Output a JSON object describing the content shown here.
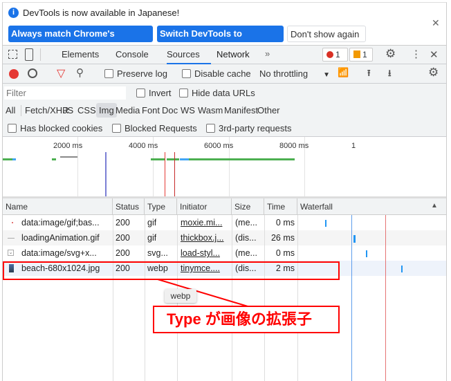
{
  "infobar": {
    "message": "DevTools is now available in Japanese!",
    "buttons": [
      "Always match Chrome's language",
      "Switch DevTools to Japanese",
      "Don't show again"
    ]
  },
  "tabs": [
    "Elements",
    "Console",
    "Sources",
    "Network"
  ],
  "active_tab": "Network",
  "badges": {
    "errors": "1",
    "warnings": "1"
  },
  "toolbar": {
    "preserve_log": "Preserve log",
    "disable_cache": "Disable cache",
    "throttling": "No throttling"
  },
  "filter": {
    "placeholder": "Filter",
    "invert": "Invert",
    "hide_data_urls": "Hide data URLs"
  },
  "types": [
    "All",
    "Fetch/XHR",
    "JS",
    "CSS",
    "Img",
    "Media",
    "Font",
    "Doc",
    "WS",
    "Wasm",
    "Manifest",
    "Other"
  ],
  "active_type": "Img",
  "blocked": [
    "Has blocked cookies",
    "Blocked Requests",
    "3rd-party requests"
  ],
  "overview": {
    "ticks": [
      "2000 ms",
      "4000 ms",
      "6000 ms",
      "8000 ms",
      "1"
    ]
  },
  "table": {
    "headers": [
      "Name",
      "Status",
      "Type",
      "Initiator",
      "Size",
      "Time",
      "Waterfall"
    ],
    "rows": [
      {
        "name": "data:image/gif;bas...",
        "status": "200",
        "type": "gif",
        "initiator": "moxie.mi...",
        "size": "(me...",
        "time": "0 ms"
      },
      {
        "name": "loadingAnimation.gif",
        "status": "200",
        "type": "gif",
        "initiator": "thickbox.j...",
        "size": "(dis...",
        "time": "26 ms"
      },
      {
        "name": "data:image/svg+x...",
        "status": "200",
        "type": "svg...",
        "initiator": "load-styl...",
        "size": "(me...",
        "time": "0 ms"
      },
      {
        "name": "beach-680x1024.jpg",
        "status": "200",
        "type": "webp",
        "initiator": "tinymce....",
        "size": "(dis...",
        "time": "2 ms"
      }
    ]
  },
  "tooltip": "webp",
  "annotation": "Type が画像の拡張子",
  "colors": {
    "accent": "#1a73e8",
    "annotation": "#ff0000"
  }
}
